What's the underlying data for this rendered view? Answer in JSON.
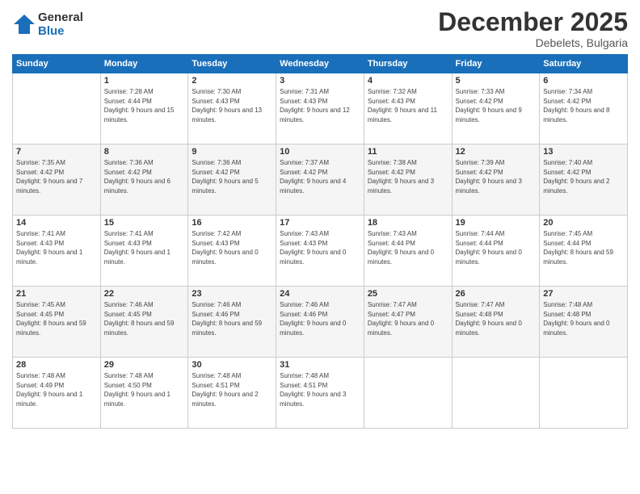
{
  "logo": {
    "general": "General",
    "blue": "Blue"
  },
  "title": "December 2025",
  "location": "Debelets, Bulgaria",
  "days_header": [
    "Sunday",
    "Monday",
    "Tuesday",
    "Wednesday",
    "Thursday",
    "Friday",
    "Saturday"
  ],
  "weeks": [
    [
      {
        "day": "",
        "sunrise": "",
        "sunset": "",
        "daylight": ""
      },
      {
        "day": "1",
        "sunrise": "Sunrise: 7:28 AM",
        "sunset": "Sunset: 4:44 PM",
        "daylight": "Daylight: 9 hours and 15 minutes."
      },
      {
        "day": "2",
        "sunrise": "Sunrise: 7:30 AM",
        "sunset": "Sunset: 4:43 PM",
        "daylight": "Daylight: 9 hours and 13 minutes."
      },
      {
        "day": "3",
        "sunrise": "Sunrise: 7:31 AM",
        "sunset": "Sunset: 4:43 PM",
        "daylight": "Daylight: 9 hours and 12 minutes."
      },
      {
        "day": "4",
        "sunrise": "Sunrise: 7:32 AM",
        "sunset": "Sunset: 4:43 PM",
        "daylight": "Daylight: 9 hours and 11 minutes."
      },
      {
        "day": "5",
        "sunrise": "Sunrise: 7:33 AM",
        "sunset": "Sunset: 4:42 PM",
        "daylight": "Daylight: 9 hours and 9 minutes."
      },
      {
        "day": "6",
        "sunrise": "Sunrise: 7:34 AM",
        "sunset": "Sunset: 4:42 PM",
        "daylight": "Daylight: 9 hours and 8 minutes."
      }
    ],
    [
      {
        "day": "7",
        "sunrise": "Sunrise: 7:35 AM",
        "sunset": "Sunset: 4:42 PM",
        "daylight": "Daylight: 9 hours and 7 minutes."
      },
      {
        "day": "8",
        "sunrise": "Sunrise: 7:36 AM",
        "sunset": "Sunset: 4:42 PM",
        "daylight": "Daylight: 9 hours and 6 minutes."
      },
      {
        "day": "9",
        "sunrise": "Sunrise: 7:36 AM",
        "sunset": "Sunset: 4:42 PM",
        "daylight": "Daylight: 9 hours and 5 minutes."
      },
      {
        "day": "10",
        "sunrise": "Sunrise: 7:37 AM",
        "sunset": "Sunset: 4:42 PM",
        "daylight": "Daylight: 9 hours and 4 minutes."
      },
      {
        "day": "11",
        "sunrise": "Sunrise: 7:38 AM",
        "sunset": "Sunset: 4:42 PM",
        "daylight": "Daylight: 9 hours and 3 minutes."
      },
      {
        "day": "12",
        "sunrise": "Sunrise: 7:39 AM",
        "sunset": "Sunset: 4:42 PM",
        "daylight": "Daylight: 9 hours and 3 minutes."
      },
      {
        "day": "13",
        "sunrise": "Sunrise: 7:40 AM",
        "sunset": "Sunset: 4:42 PM",
        "daylight": "Daylight: 9 hours and 2 minutes."
      }
    ],
    [
      {
        "day": "14",
        "sunrise": "Sunrise: 7:41 AM",
        "sunset": "Sunset: 4:43 PM",
        "daylight": "Daylight: 9 hours and 1 minute."
      },
      {
        "day": "15",
        "sunrise": "Sunrise: 7:41 AM",
        "sunset": "Sunset: 4:43 PM",
        "daylight": "Daylight: 9 hours and 1 minute."
      },
      {
        "day": "16",
        "sunrise": "Sunrise: 7:42 AM",
        "sunset": "Sunset: 4:43 PM",
        "daylight": "Daylight: 9 hours and 0 minutes."
      },
      {
        "day": "17",
        "sunrise": "Sunrise: 7:43 AM",
        "sunset": "Sunset: 4:43 PM",
        "daylight": "Daylight: 9 hours and 0 minutes."
      },
      {
        "day": "18",
        "sunrise": "Sunrise: 7:43 AM",
        "sunset": "Sunset: 4:44 PM",
        "daylight": "Daylight: 9 hours and 0 minutes."
      },
      {
        "day": "19",
        "sunrise": "Sunrise: 7:44 AM",
        "sunset": "Sunset: 4:44 PM",
        "daylight": "Daylight: 9 hours and 0 minutes."
      },
      {
        "day": "20",
        "sunrise": "Sunrise: 7:45 AM",
        "sunset": "Sunset: 4:44 PM",
        "daylight": "Daylight: 8 hours and 59 minutes."
      }
    ],
    [
      {
        "day": "21",
        "sunrise": "Sunrise: 7:45 AM",
        "sunset": "Sunset: 4:45 PM",
        "daylight": "Daylight: 8 hours and 59 minutes."
      },
      {
        "day": "22",
        "sunrise": "Sunrise: 7:46 AM",
        "sunset": "Sunset: 4:45 PM",
        "daylight": "Daylight: 8 hours and 59 minutes."
      },
      {
        "day": "23",
        "sunrise": "Sunrise: 7:46 AM",
        "sunset": "Sunset: 4:46 PM",
        "daylight": "Daylight: 8 hours and 59 minutes."
      },
      {
        "day": "24",
        "sunrise": "Sunrise: 7:46 AM",
        "sunset": "Sunset: 4:46 PM",
        "daylight": "Daylight: 9 hours and 0 minutes."
      },
      {
        "day": "25",
        "sunrise": "Sunrise: 7:47 AM",
        "sunset": "Sunset: 4:47 PM",
        "daylight": "Daylight: 9 hours and 0 minutes."
      },
      {
        "day": "26",
        "sunrise": "Sunrise: 7:47 AM",
        "sunset": "Sunset: 4:48 PM",
        "daylight": "Daylight: 9 hours and 0 minutes."
      },
      {
        "day": "27",
        "sunrise": "Sunrise: 7:48 AM",
        "sunset": "Sunset: 4:48 PM",
        "daylight": "Daylight: 9 hours and 0 minutes."
      }
    ],
    [
      {
        "day": "28",
        "sunrise": "Sunrise: 7:48 AM",
        "sunset": "Sunset: 4:49 PM",
        "daylight": "Daylight: 9 hours and 1 minute."
      },
      {
        "day": "29",
        "sunrise": "Sunrise: 7:48 AM",
        "sunset": "Sunset: 4:50 PM",
        "daylight": "Daylight: 9 hours and 1 minute."
      },
      {
        "day": "30",
        "sunrise": "Sunrise: 7:48 AM",
        "sunset": "Sunset: 4:51 PM",
        "daylight": "Daylight: 9 hours and 2 minutes."
      },
      {
        "day": "31",
        "sunrise": "Sunrise: 7:48 AM",
        "sunset": "Sunset: 4:51 PM",
        "daylight": "Daylight: 9 hours and 3 minutes."
      },
      {
        "day": "",
        "sunrise": "",
        "sunset": "",
        "daylight": ""
      },
      {
        "day": "",
        "sunrise": "",
        "sunset": "",
        "daylight": ""
      },
      {
        "day": "",
        "sunrise": "",
        "sunset": "",
        "daylight": ""
      }
    ]
  ]
}
